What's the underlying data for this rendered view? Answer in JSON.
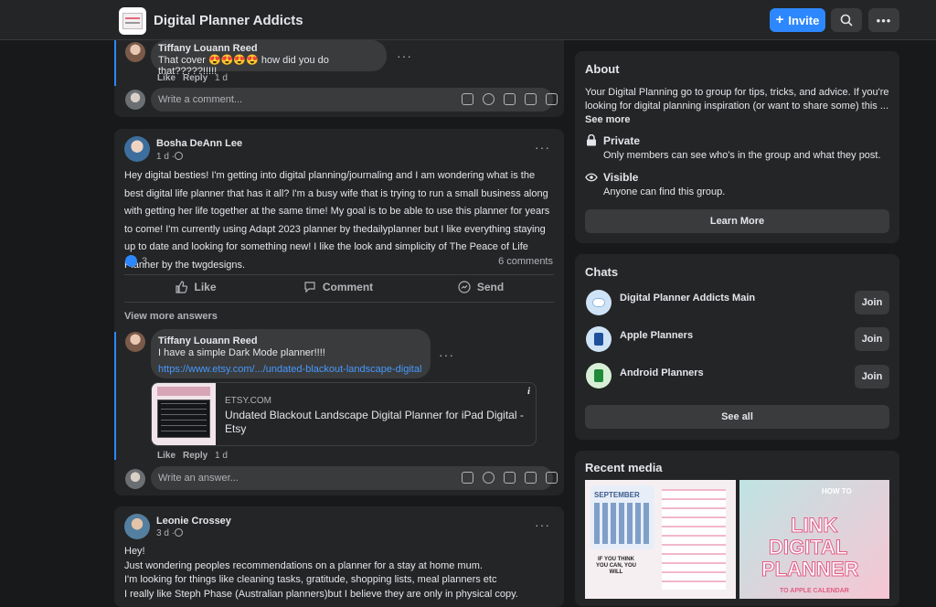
{
  "header": {
    "group_name": "Digital Planner Addicts",
    "invite_label": "Invite"
  },
  "top_comment": {
    "author": "Tiffany Louann Reed",
    "text": "That cover 😍😍😍😍 how did you do that?????!!!!!",
    "like": "Like",
    "reply": "Reply",
    "time": "1 d"
  },
  "composer1": {
    "placeholder": "Write a comment..."
  },
  "post1": {
    "author": "Bosha DeAnn Lee",
    "time": "1 d ·",
    "body": "Hey digital besties! I'm getting into digital planning/journaling and I am wondering what is the best digital life planner that has it all? I'm a busy wife that is trying to run a small business along with getting her life together at the same time! My goal is to be able to use this planner for years to come! I'm currently using Adapt 2023 planner by thedailyplanner but I like everything staying up to date and looking for something new! I like the look and simplicity of The Peace of Life Planner by the twgdesigns.",
    "reactions": "3",
    "comments": "6 comments",
    "actions": {
      "like": "Like",
      "comment": "Comment",
      "send": "Send"
    },
    "view_more": "View more answers",
    "reply": {
      "author": "Tiffany Louann Reed",
      "text": "I have a simple Dark Mode planner!!!!",
      "link": "https://www.etsy.com/.../undated-blackout-landscape-digital",
      "preview_domain": "ETSY.COM",
      "preview_title": "Undated Blackout Landscape Digital Planner for iPad Digital - Etsy",
      "like": "Like",
      "reply_label": "Reply",
      "time": "1 d"
    },
    "composer_placeholder": "Write an answer..."
  },
  "post2": {
    "author": "Leonie Crossey",
    "time": "3 d ·",
    "lines": [
      "Hey!",
      "Just wondering peoples recommendations on a planner for a stay at home mum.",
      "I'm looking for things like cleaning tasks, gratitude, shopping lists, meal planners etc",
      "I really like Steph Phase (Australian planners)but I believe they are only in physical copy."
    ]
  },
  "about": {
    "title": "About",
    "description": "Your Digital Planning go to group for tips, tricks, and advice. If you're looking for digital planning inspiration (or want to share some) this ...",
    "see_more": "See more",
    "private_title": "Private",
    "private_desc": "Only members can see who's in the group and what they post.",
    "visible_title": "Visible",
    "visible_desc": "Anyone can find this group.",
    "learn_more": "Learn More"
  },
  "chats": {
    "title": "Chats",
    "items": [
      {
        "name": "Digital Planner Addicts Main",
        "join": "Join"
      },
      {
        "name": "Apple Planners",
        "join": "Join"
      },
      {
        "name": "Android Planners",
        "join": "Join"
      }
    ],
    "see_all": "See all"
  },
  "media": {
    "title": "Recent media",
    "thumb1": {
      "month": "SEPTEMBER",
      "note": "IF YOU THINK YOU CAN, YOU WILL"
    },
    "thumb2": {
      "line1": "HOW TO",
      "line2": "LINK",
      "line3": "DIGITAL",
      "line4": "PLANNER",
      "line5": "TO APPLE CALENDAR"
    }
  },
  "colors": {
    "accent": "#2d88ff",
    "background": "#18191a",
    "card": "#242526"
  }
}
